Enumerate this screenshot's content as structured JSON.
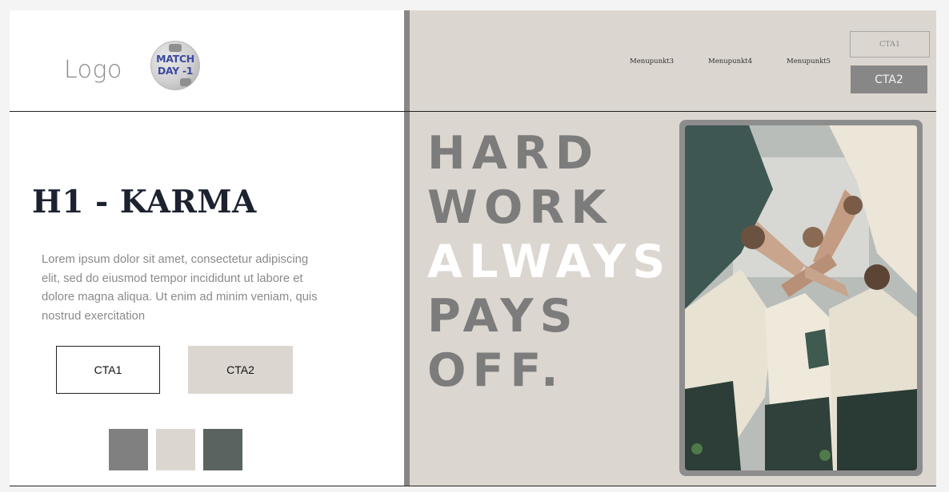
{
  "brand": {
    "logo_text": "Logo",
    "badge_line1": "MATCH",
    "badge_line2": "DAY -1"
  },
  "hero": {
    "heading": "H1 - KARMA",
    "body": "Lorem ipsum dolor sit amet, consectetur adipiscing elit, sed do eiusmod tempor incididunt ut labore et dolore magna aliqua. Ut enim ad minim veniam, quis nostrud exercitation",
    "cta1_label": "CTA1",
    "cta2_label": "CTA2"
  },
  "palette": {
    "swatches": [
      "#808080",
      "#dcd6d0",
      "#5a635f"
    ]
  },
  "nav": {
    "items": [
      "Menupunkt3",
      "Menupunkt4",
      "Menupunkt5"
    ],
    "cta1_label": "CTA1",
    "cta2_label": "CTA2"
  },
  "slogan": {
    "line1": "HARD",
    "line2": "WORK",
    "line3": "ALWAYS",
    "line4": "PAYS",
    "line5": "OFF."
  },
  "colors": {
    "panel_bg": "#dcd6d0",
    "accent_gray": "#878787",
    "heading": "#1c2230",
    "body_text": "#8a8a8a"
  }
}
